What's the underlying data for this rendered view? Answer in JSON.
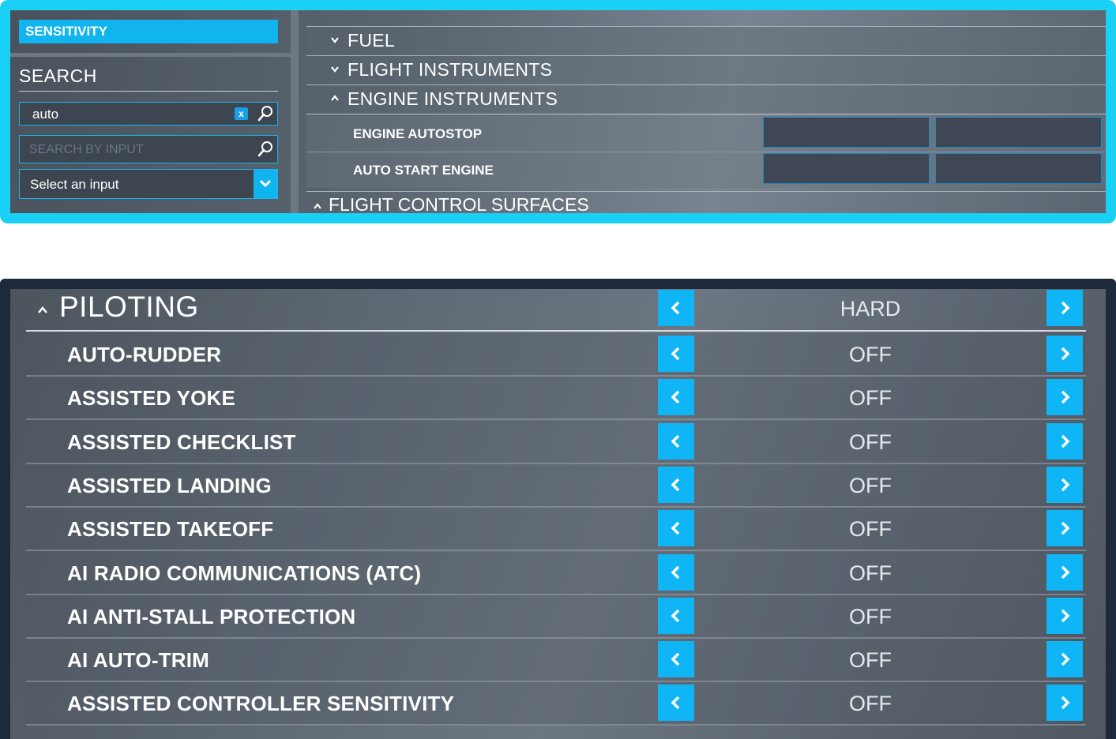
{
  "top_panel": {
    "sensitivity_tab": "SENSITIVITY",
    "search_title": "SEARCH",
    "search_value": "auto",
    "clear_label": "x",
    "search_by_input_placeholder": "SEARCH BY INPUT",
    "select_input_value": "Select an input",
    "categories": [
      {
        "label": "FUEL",
        "expanded": false
      },
      {
        "label": "FLIGHT INSTRUMENTS",
        "expanded": false
      },
      {
        "label": "ENGINE INSTRUMENTS",
        "expanded": true
      }
    ],
    "bindings": [
      {
        "label": "ENGINE AUTOSTOP"
      },
      {
        "label": "AUTO START ENGINE"
      }
    ],
    "last_category": {
      "label": "FLIGHT CONTROL SURFACES",
      "expanded": true
    }
  },
  "bottom_panel": {
    "section_title": "PILOTING",
    "section_value": "HARD",
    "options": [
      {
        "label": "AUTO-RUDDER",
        "value": "OFF"
      },
      {
        "label": "ASSISTED YOKE",
        "value": "OFF"
      },
      {
        "label": "ASSISTED CHECKLIST",
        "value": "OFF"
      },
      {
        "label": "ASSISTED LANDING",
        "value": "OFF"
      },
      {
        "label": "ASSISTED TAKEOFF",
        "value": "OFF"
      },
      {
        "label": "AI RADIO COMMUNICATIONS (ATC)",
        "value": "OFF"
      },
      {
        "label": "AI ANTI-STALL PROTECTION",
        "value": "OFF"
      },
      {
        "label": "AI AUTO-TRIM",
        "value": "OFF"
      },
      {
        "label": "ASSISTED CONTROLLER SENSITIVITY",
        "value": "OFF"
      }
    ]
  },
  "colors": {
    "accent": "#10b5f0",
    "frame_top": "#1ad0f5",
    "frame_bottom": "#1d2a3c"
  }
}
